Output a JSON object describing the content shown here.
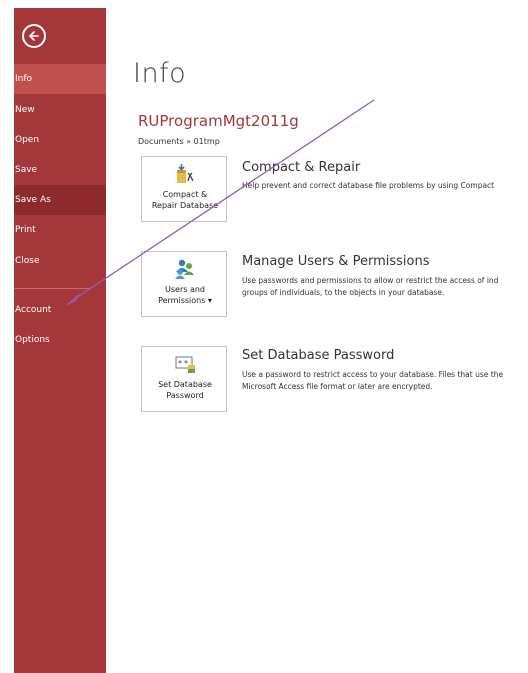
{
  "sidebar": {
    "items": [
      {
        "label": "Info"
      },
      {
        "label": "New"
      },
      {
        "label": "Open"
      },
      {
        "label": "Save"
      },
      {
        "label": "Save As"
      },
      {
        "label": "Print"
      },
      {
        "label": "Close"
      },
      {
        "label": "Account"
      },
      {
        "label": "Options"
      }
    ],
    "active": "Info",
    "accent_color": "#a4373a"
  },
  "main": {
    "title": "Info",
    "db_name": "RUProgramMgt2011g",
    "breadcrumb": "Documents » 01tmp",
    "sections": [
      {
        "tile_line1": "Compact &",
        "tile_line2": "Repair Database",
        "icon": "compact-repair-icon",
        "title": "Compact & Repair",
        "desc_line1": "Help prevent and correct database file problems by using Compact"
      },
      {
        "tile_line1": "Users and",
        "tile_line2": "Permissions ▾",
        "icon": "users-permissions-icon",
        "title": "Manage Users & Permissions",
        "desc_line1": "Use passwords and permissions to allow or restrict the access of ind",
        "desc_line2": "groups of individuals, to the objects in your database."
      },
      {
        "tile_line1": "Set Database",
        "tile_line2": "Password",
        "icon": "password-icon",
        "title": "Set Database Password",
        "desc_line1": "Use a password to restrict access to your database. Files that use the",
        "desc_line2": "Microsoft Access file format or later are encrypted."
      }
    ]
  },
  "annotation": {
    "color": "#9b59b6"
  }
}
